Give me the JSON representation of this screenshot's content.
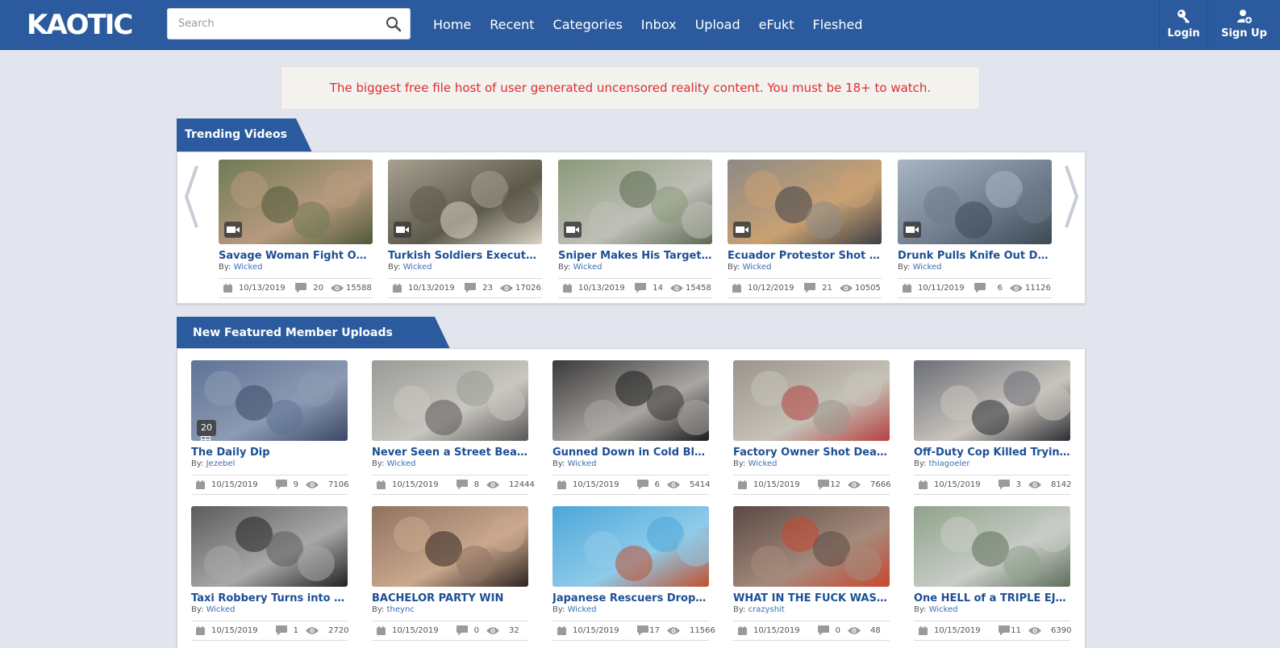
{
  "header": {
    "logo_text": "KAOTIC",
    "search_placeholder": "Search",
    "nav": [
      "Home",
      "Recent",
      "Categories",
      "Inbox",
      "Upload",
      "eFukt",
      "Fleshed"
    ],
    "login_label": "Login",
    "signup_label": "Sign Up"
  },
  "notice": "The biggest free file host of user generated uncensored reality content. You must be 18+ to watch.",
  "trending": {
    "heading": "Trending Videos",
    "by_prefix": "By:",
    "items": [
      {
        "title": "Savage Woman Fight Over …",
        "author": "Wicked",
        "date": "10/13/2019",
        "comments": "20",
        "views": "15588",
        "colors": [
          "#6d7a55",
          "#b89a7e",
          "#4f5a3a"
        ]
      },
      {
        "title": "Turkish Soldiers Execute K…",
        "author": "Wicked",
        "date": "10/13/2019",
        "comments": "23",
        "views": "17026",
        "colors": [
          "#a8a191",
          "#5d5a4c",
          "#d9d3c4"
        ]
      },
      {
        "title": "Sniper Makes His Target S…",
        "author": "Wicked",
        "date": "10/13/2019",
        "comments": "14",
        "views": "15458",
        "colors": [
          "#8b9a7a",
          "#bfbfb7",
          "#5c6b52"
        ]
      },
      {
        "title": "Ecuador Protestor Shot in t…",
        "author": "Wicked",
        "date": "10/12/2019",
        "comments": "21",
        "views": "10505",
        "colors": [
          "#8c8a86",
          "#c9a172",
          "#3d3f47"
        ]
      },
      {
        "title": "Drunk Pulls Knife Out Duri…",
        "author": "Wicked",
        "date": "10/11/2019",
        "comments": "6",
        "views": "11126",
        "colors": [
          "#a8b6c4",
          "#6d7b8a",
          "#3d4955"
        ]
      }
    ]
  },
  "featured": {
    "heading": "New Featured Member Uploads",
    "by_prefix": "By:",
    "items": [
      {
        "title": "The Daily Dip",
        "author": "Jezebel",
        "date": "10/15/2019",
        "comments": "9",
        "views": "7106",
        "badge": "20",
        "colors": [
          "#5f7395",
          "#8c9ab3",
          "#3a4866"
        ]
      },
      {
        "title": "Never Seen a Street Beatin…",
        "author": "Wicked",
        "date": "10/15/2019",
        "comments": "8",
        "views": "12444",
        "colors": [
          "#9a9a96",
          "#c8c6c0",
          "#5a5856"
        ]
      },
      {
        "title": "Gunned Down in Cold Blood",
        "author": "Wicked",
        "date": "10/15/2019",
        "comments": "6",
        "views": "5414",
        "colors": [
          "#3b3a3a",
          "#a9a6a2",
          "#1c1b1b"
        ]
      },
      {
        "title": "Factory Owner Shot Dead i…",
        "author": "Wicked",
        "date": "10/15/2019",
        "comments": "12",
        "views": "7666",
        "colors": [
          "#9a958b",
          "#c6c2b8",
          "#b4413f"
        ]
      },
      {
        "title": "Off-Duty Cop Killed Trying t…",
        "author": "thiagoeler",
        "date": "10/15/2019",
        "comments": "3",
        "views": "8142",
        "colors": [
          "#6a6e77",
          "#c9c4bd",
          "#2c2d33"
        ]
      },
      {
        "title": "Taxi Robbery Turns into a S…",
        "author": "Wicked",
        "date": "10/15/2019",
        "comments": "1",
        "views": "2720",
        "colors": [
          "#5c5c5c",
          "#a8a8a8",
          "#222222"
        ]
      },
      {
        "title": "BACHELOR PARTY WIN",
        "author": "theync",
        "date": "10/15/2019",
        "comments": "0",
        "views": "32",
        "colors": [
          "#8f7260",
          "#caa88e",
          "#2d2420"
        ]
      },
      {
        "title": "Japanese Rescuers Drop W…",
        "author": "Wicked",
        "date": "10/15/2019",
        "comments": "17",
        "views": "11566",
        "colors": [
          "#4ca6d8",
          "#8fcbea",
          "#c0512f"
        ]
      },
      {
        "title": "WHAT IN THE FUCK WAS T…",
        "author": "crazyshit",
        "date": "10/15/2019",
        "comments": "0",
        "views": "48",
        "colors": [
          "#5a4a44",
          "#a58a7c",
          "#c9472f"
        ]
      },
      {
        "title": "One HELL of a TRIPLE EJEC…",
        "author": "Wicked",
        "date": "10/15/2019",
        "comments": "11",
        "views": "6390",
        "colors": [
          "#8fa38a",
          "#c8ccc7",
          "#5d6f5a"
        ]
      }
    ]
  }
}
